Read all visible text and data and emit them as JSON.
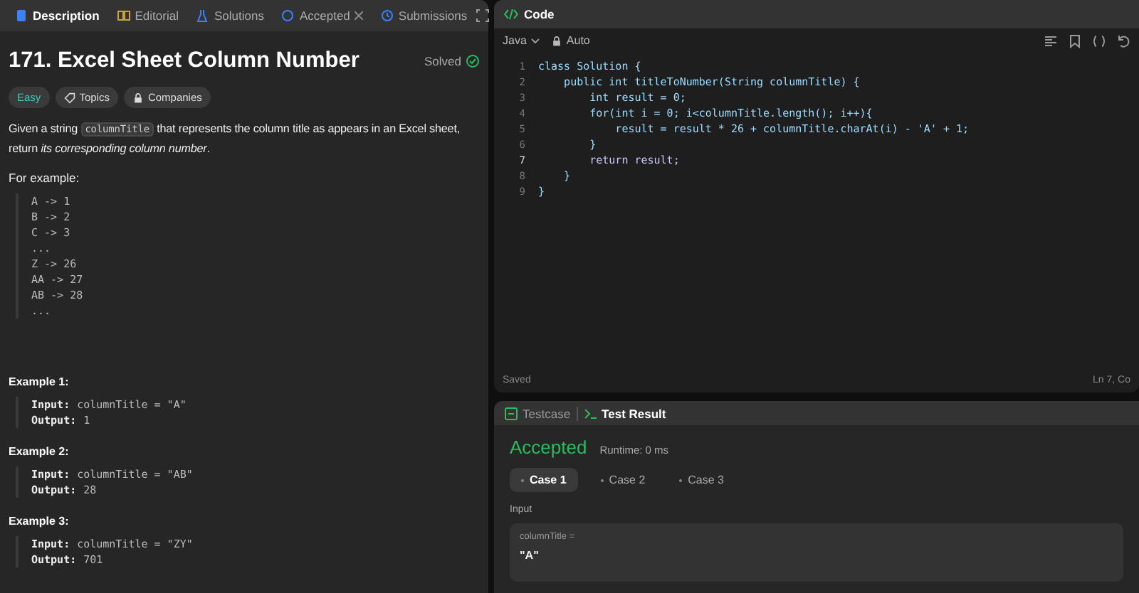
{
  "description_panel": {
    "tabs": [
      {
        "label": "Description",
        "selected": true,
        "closable": false
      },
      {
        "label": "Editorial",
        "selected": false,
        "closable": false
      },
      {
        "label": "Solutions",
        "selected": false,
        "closable": false
      },
      {
        "label": "Accepted",
        "selected": false,
        "closable": true
      },
      {
        "label": "Submissions",
        "selected": false,
        "closable": false
      }
    ],
    "title": "171. Excel Sheet Column Number",
    "status": "Solved",
    "tags": [
      {
        "label": "Easy",
        "kind": "difficulty"
      },
      {
        "label": "Topics",
        "kind": "topics"
      },
      {
        "label": "Companies",
        "kind": "companies"
      }
    ],
    "statement": [
      {
        "kind": "text",
        "text": "Given a string "
      },
      {
        "kind": "code",
        "text": "columnTitle"
      },
      {
        "kind": "text",
        "text": " that represents the column title as appears in an Excel sheet, return *its corresponding column number*."
      }
    ],
    "example_intro": "For example:",
    "mapping": [
      "A -> 1",
      "B -> 2",
      "C -> 3",
      "...",
      "Z -> 26",
      "AA -> 27",
      "AB -> 28",
      "..."
    ],
    "examples": [
      {
        "title": "Example 1:",
        "input_label": "Input:",
        "input": "columnTitle = \"A\"",
        "output_label": "Output:",
        "output": "1"
      },
      {
        "title": "Example 2:",
        "input_label": "Input:",
        "input": "columnTitle = \"AB\"",
        "output_label": "Output:",
        "output": "28"
      },
      {
        "title": "Example 3:",
        "input_label": "Input:",
        "input": "columnTitle = \"ZY\"",
        "output_label": "Output:",
        "output": "701"
      }
    ]
  },
  "code_panel": {
    "title": "Code",
    "language": "Java",
    "mode": "Auto",
    "lines": [
      {
        "number": "1",
        "text": "class Solution {",
        "current": false
      },
      {
        "number": "2",
        "text": "    public int titleToNumber(String columnTitle) {",
        "current": false
      },
      {
        "number": "3",
        "text": "        int result = 0;",
        "current": false
      },
      {
        "number": "4",
        "text": "        for(int i = 0; i<columnTitle.length(); i++){",
        "current": false
      },
      {
        "number": "5",
        "text": "            result = result * 26 + columnTitle.charAt(i) - 'A' + 1;",
        "current": false
      },
      {
        "number": "6",
        "text": "        }",
        "current": false
      },
      {
        "number": "7",
        "text": "        return result;",
        "current": true
      },
      {
        "number": "8",
        "text": "    }",
        "current": false
      },
      {
        "number": "9",
        "text": "}",
        "current": false
      }
    ],
    "status": "Saved",
    "cursor": "Ln 7, Co"
  },
  "result_panel": {
    "tabs": [
      {
        "label": "Testcase",
        "selected": false
      },
      {
        "label": "Test Result",
        "selected": true
      }
    ],
    "verdict": "Accepted",
    "runtime": "Runtime: 0 ms",
    "cases": [
      {
        "label": "Case 1",
        "selected": true
      },
      {
        "label": "Case 2",
        "selected": false
      },
      {
        "label": "Case 3",
        "selected": false
      }
    ],
    "input_heading": "Input",
    "input_name": "columnTitle =",
    "input_value": "\"A\""
  }
}
